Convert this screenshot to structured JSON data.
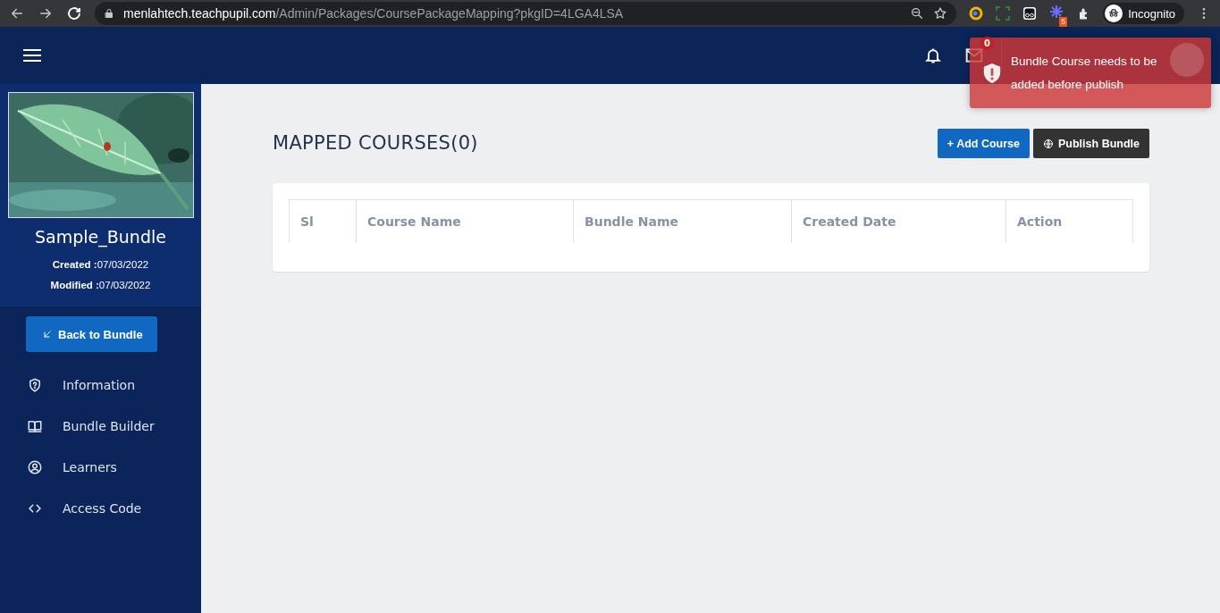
{
  "browser": {
    "url_host": "menlahtech.teachpupil.com",
    "url_path": "/Admin/Packages/CoursePackageMapping?pkgID=4LGA4LSA",
    "extension_badge": "5",
    "profile_label": "Incognito"
  },
  "header": {
    "mail_badge": "0"
  },
  "toast": {
    "message": "Bundle Course needs to be added before publish"
  },
  "sidebar": {
    "bundle_name": "Sample_Bundle",
    "created_label": "Created :",
    "created": "07/03/2022",
    "modified_label": "Modified :",
    "modified": "07/03/2022",
    "back_button": "Back to Bundle",
    "items": [
      {
        "kind": "shield",
        "label": "Information"
      },
      {
        "kind": "book",
        "label": "Bundle Builder"
      },
      {
        "kind": "user",
        "label": "Learners"
      },
      {
        "kind": "code",
        "label": "Access Code"
      }
    ]
  },
  "main": {
    "title": "MAPPED COURSES(0)",
    "buttons": [
      {
        "kind": "add",
        "label": "+ Add Course"
      },
      {
        "kind": "publish",
        "label": "Publish Bundle"
      }
    ],
    "table": {
      "columns": [
        "Sl",
        "Course Name",
        "Bundle Name",
        "Created Date",
        "Action"
      ]
    }
  }
}
